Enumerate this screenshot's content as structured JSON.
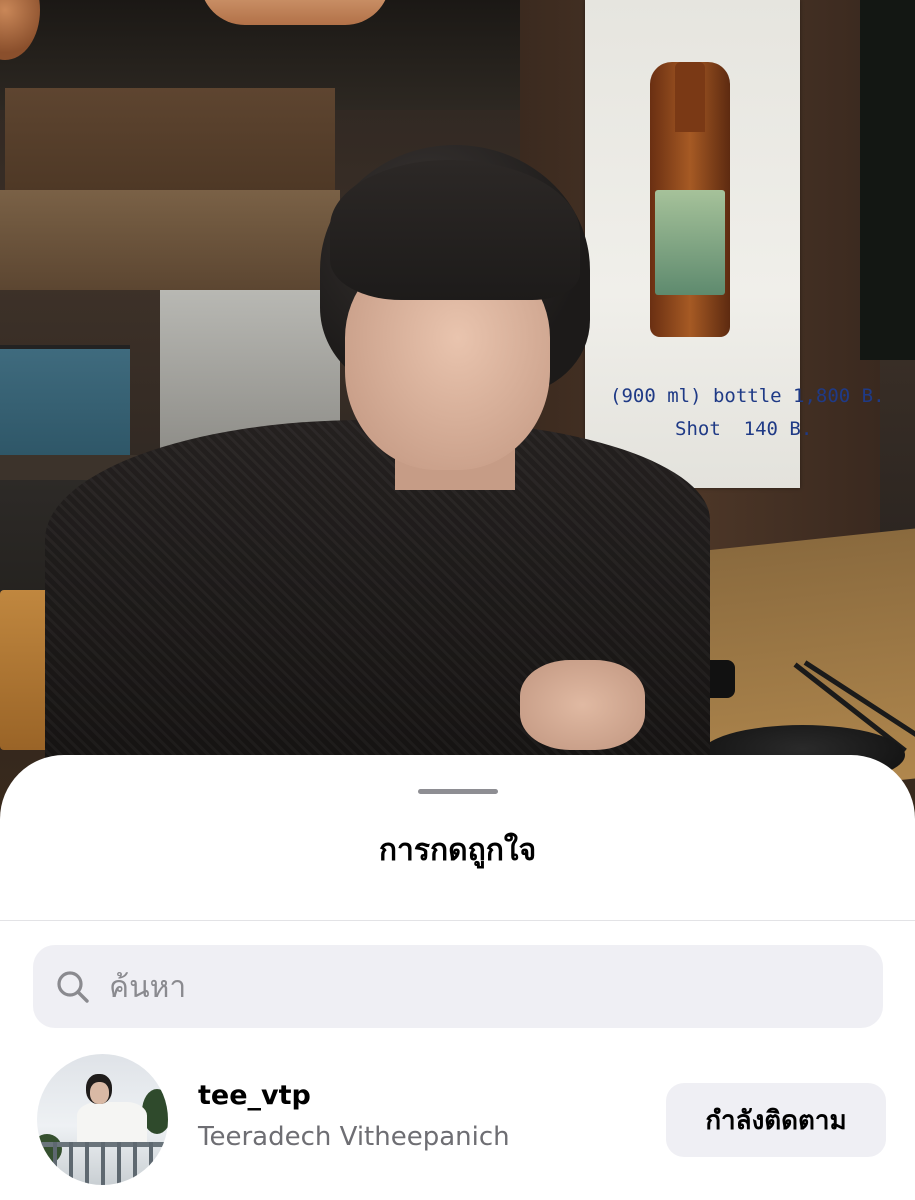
{
  "photo": {
    "description_icon": "photo-background",
    "poster": {
      "bottle_line": "(900 ml) bottle 1,800 B.",
      "shot_line": "Shot  140 B."
    }
  },
  "likes_sheet": {
    "title": "การกดถูกใจ",
    "search": {
      "placeholder": "ค้นหา",
      "icon": "search-icon"
    },
    "users": [
      {
        "username": "tee_vtp",
        "full_name": "Teeradech Vitheepanich",
        "button_label": "กำลังติดตาม"
      }
    ]
  },
  "colors": {
    "sheet_background": "#ffffff",
    "search_background": "#efeff4",
    "secondary_text": "#6e6e73",
    "poster_ink": "#1f3a86"
  }
}
